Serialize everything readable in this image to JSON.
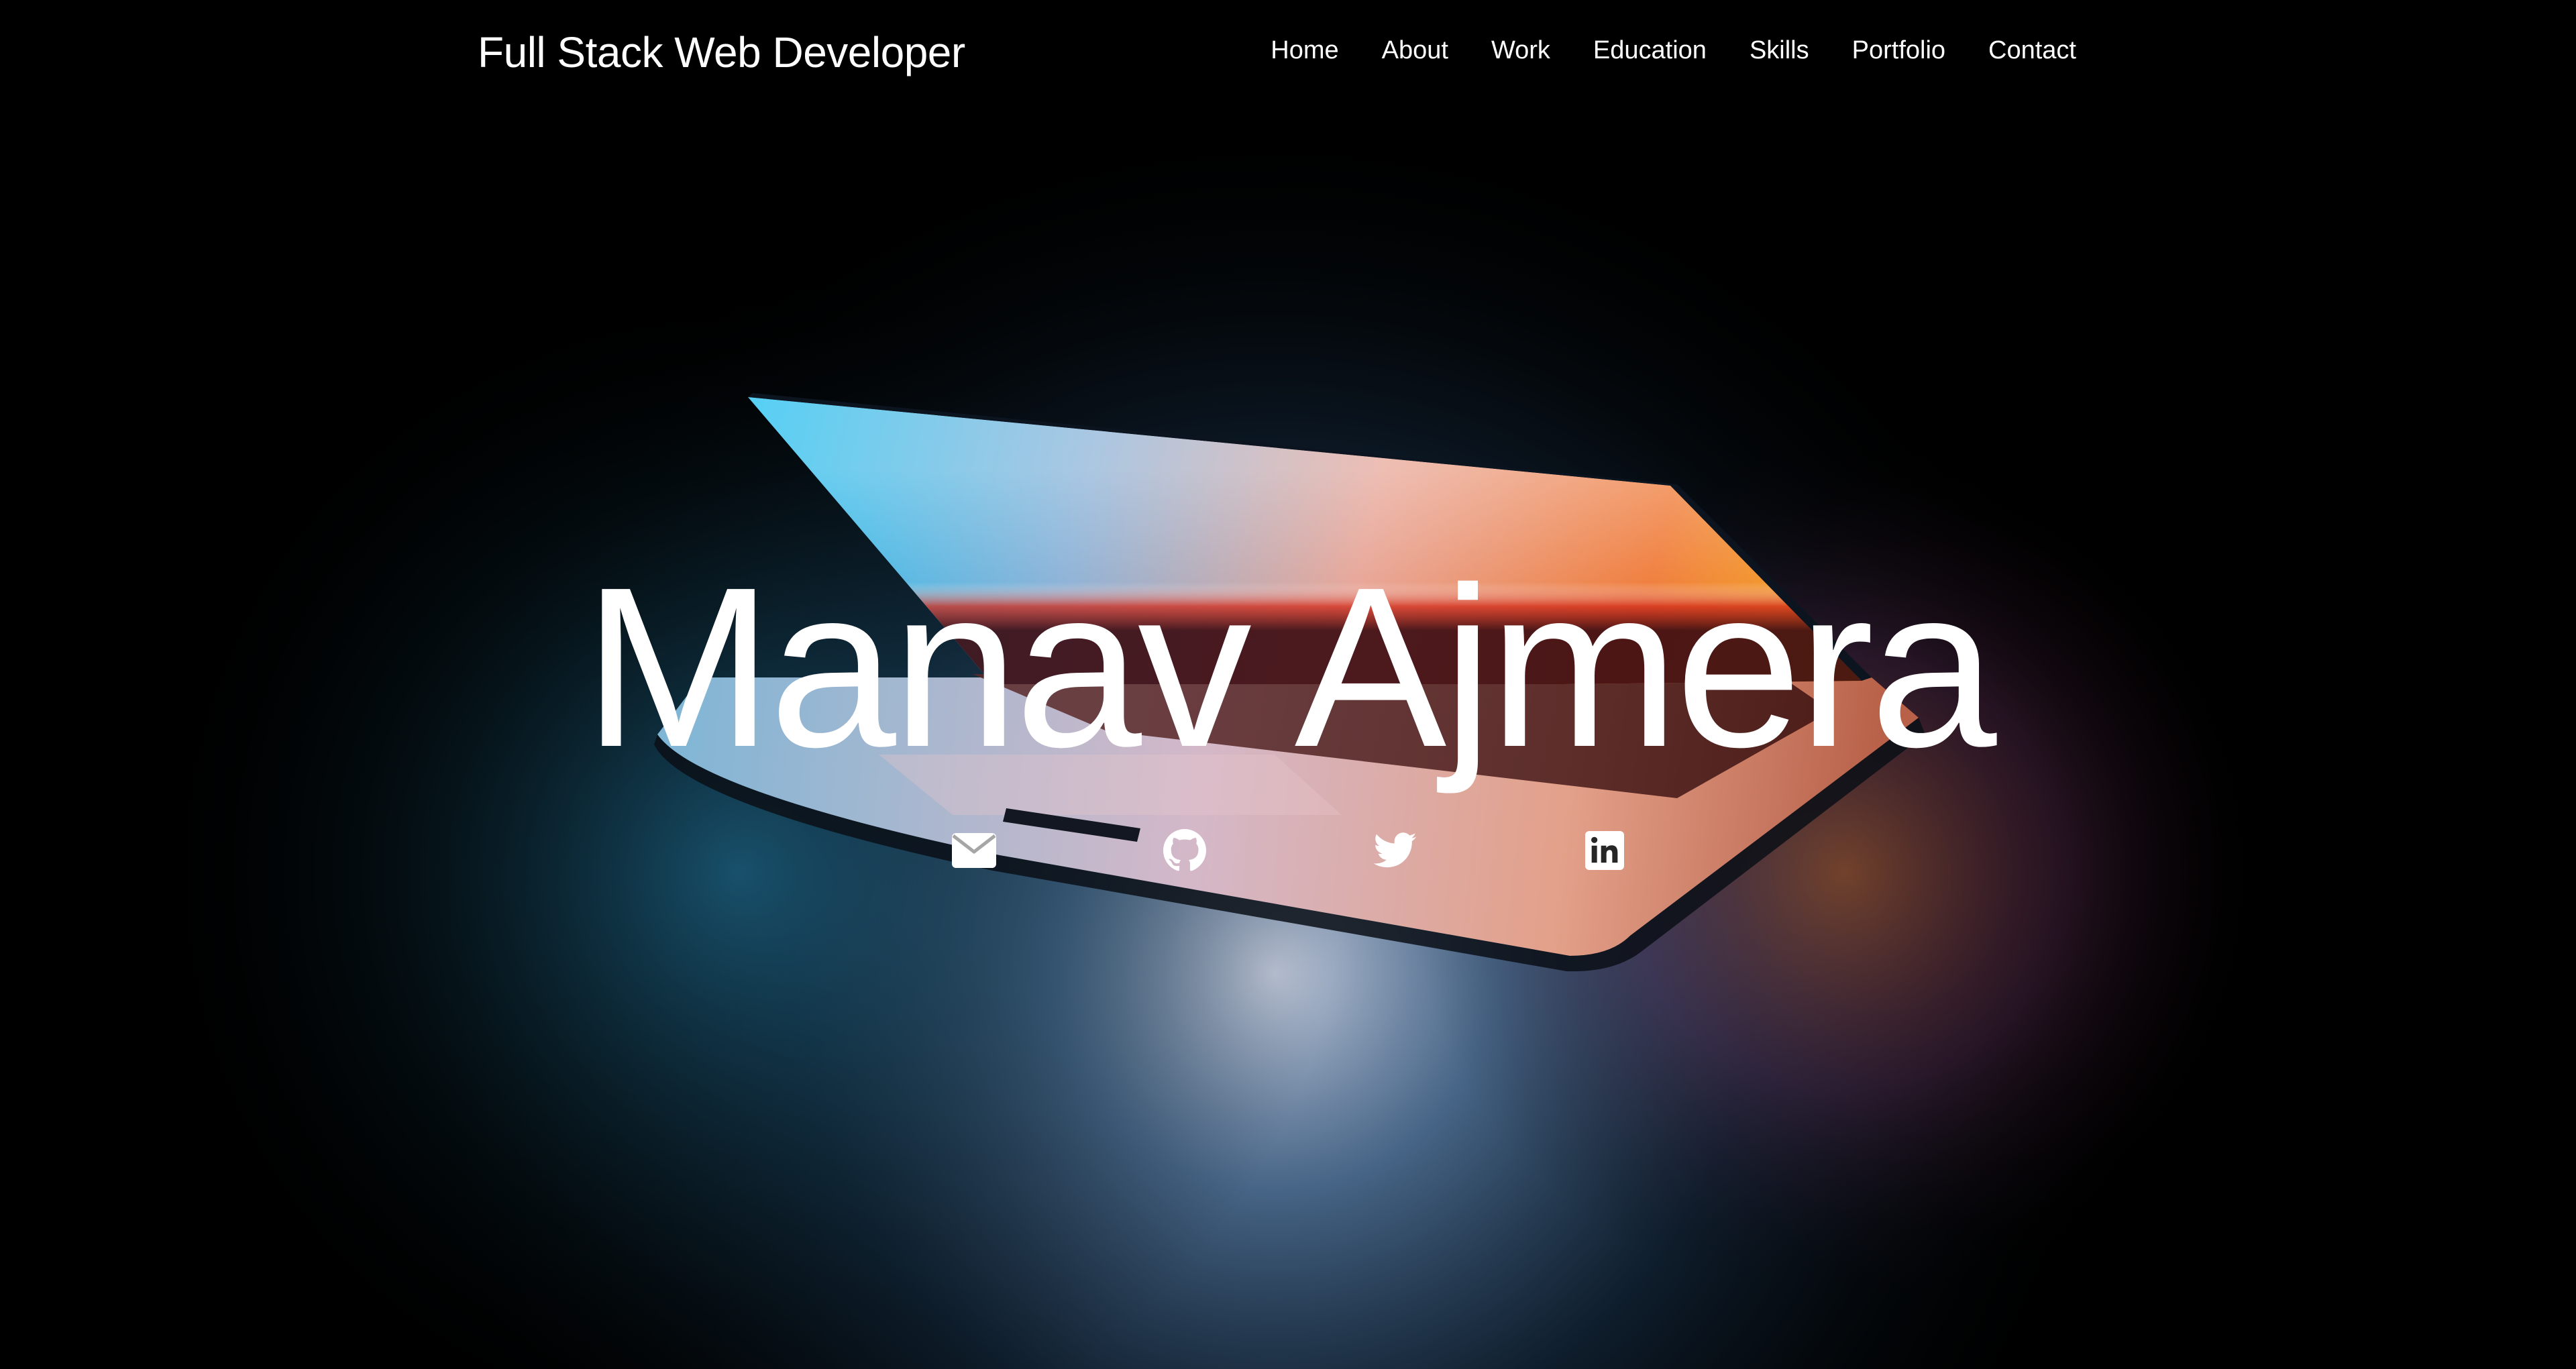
{
  "header": {
    "brand": "Full Stack Web Developer",
    "nav": [
      {
        "label": "Home"
      },
      {
        "label": "About"
      },
      {
        "label": "Work"
      },
      {
        "label": "Education"
      },
      {
        "label": "Skills"
      },
      {
        "label": "Portfolio"
      },
      {
        "label": "Contact"
      }
    ]
  },
  "hero": {
    "name": "Manav Ajmera",
    "socials": [
      {
        "icon": "envelope-icon"
      },
      {
        "icon": "github-icon"
      },
      {
        "icon": "twitter-icon"
      },
      {
        "icon": "linkedin-icon"
      }
    ]
  },
  "colors": {
    "background": "#000000",
    "text": "#ffffff"
  }
}
